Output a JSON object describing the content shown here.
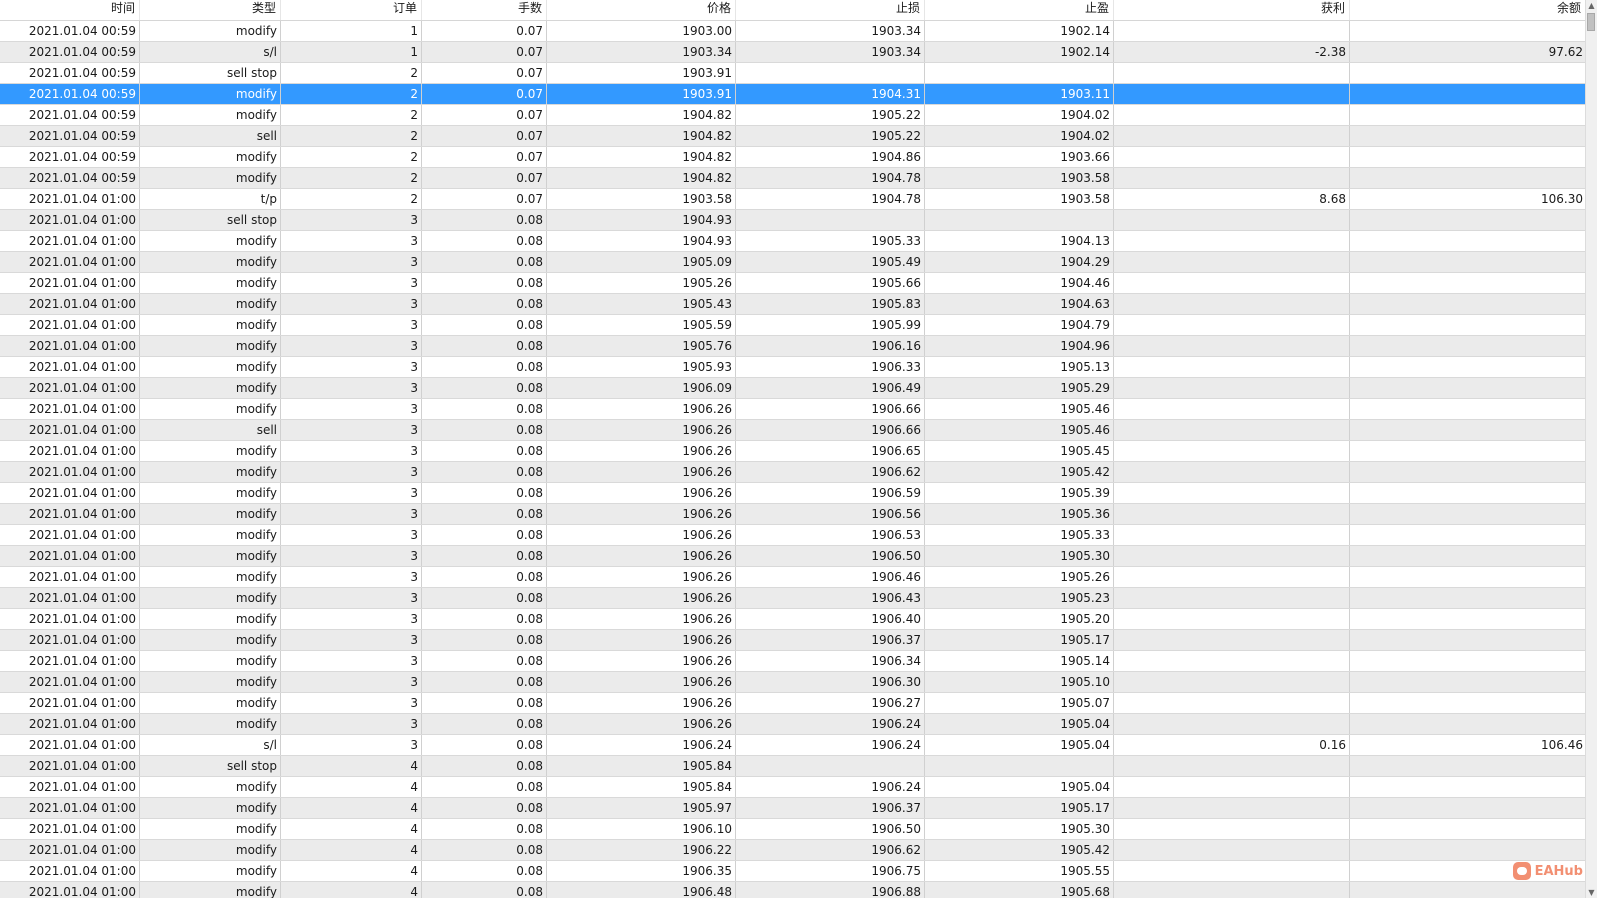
{
  "columns": [
    "时间",
    "类型",
    "订单",
    "手数",
    "价格",
    "止损",
    "止盈",
    "获利",
    "余额"
  ],
  "selected_row": 3,
  "rows": [
    [
      "2021.01.04 00:59",
      "modify",
      "1",
      "0.07",
      "1903.00",
      "1903.34",
      "1902.14",
      "",
      ""
    ],
    [
      "2021.01.04 00:59",
      "s/l",
      "1",
      "0.07",
      "1903.34",
      "1903.34",
      "1902.14",
      "-2.38",
      "97.62"
    ],
    [
      "2021.01.04 00:59",
      "sell stop",
      "2",
      "0.07",
      "1903.91",
      "",
      "",
      "",
      ""
    ],
    [
      "2021.01.04 00:59",
      "modify",
      "2",
      "0.07",
      "1903.91",
      "1904.31",
      "1903.11",
      "",
      ""
    ],
    [
      "2021.01.04 00:59",
      "modify",
      "2",
      "0.07",
      "1904.82",
      "1905.22",
      "1904.02",
      "",
      ""
    ],
    [
      "2021.01.04 00:59",
      "sell",
      "2",
      "0.07",
      "1904.82",
      "1905.22",
      "1904.02",
      "",
      ""
    ],
    [
      "2021.01.04 00:59",
      "modify",
      "2",
      "0.07",
      "1904.82",
      "1904.86",
      "1903.66",
      "",
      ""
    ],
    [
      "2021.01.04 00:59",
      "modify",
      "2",
      "0.07",
      "1904.82",
      "1904.78",
      "1903.58",
      "",
      ""
    ],
    [
      "2021.01.04 01:00",
      "t/p",
      "2",
      "0.07",
      "1903.58",
      "1904.78",
      "1903.58",
      "8.68",
      "106.30"
    ],
    [
      "2021.01.04 01:00",
      "sell stop",
      "3",
      "0.08",
      "1904.93",
      "",
      "",
      "",
      ""
    ],
    [
      "2021.01.04 01:00",
      "modify",
      "3",
      "0.08",
      "1904.93",
      "1905.33",
      "1904.13",
      "",
      ""
    ],
    [
      "2021.01.04 01:00",
      "modify",
      "3",
      "0.08",
      "1905.09",
      "1905.49",
      "1904.29",
      "",
      ""
    ],
    [
      "2021.01.04 01:00",
      "modify",
      "3",
      "0.08",
      "1905.26",
      "1905.66",
      "1904.46",
      "",
      ""
    ],
    [
      "2021.01.04 01:00",
      "modify",
      "3",
      "0.08",
      "1905.43",
      "1905.83",
      "1904.63",
      "",
      ""
    ],
    [
      "2021.01.04 01:00",
      "modify",
      "3",
      "0.08",
      "1905.59",
      "1905.99",
      "1904.79",
      "",
      ""
    ],
    [
      "2021.01.04 01:00",
      "modify",
      "3",
      "0.08",
      "1905.76",
      "1906.16",
      "1904.96",
      "",
      ""
    ],
    [
      "2021.01.04 01:00",
      "modify",
      "3",
      "0.08",
      "1905.93",
      "1906.33",
      "1905.13",
      "",
      ""
    ],
    [
      "2021.01.04 01:00",
      "modify",
      "3",
      "0.08",
      "1906.09",
      "1906.49",
      "1905.29",
      "",
      ""
    ],
    [
      "2021.01.04 01:00",
      "modify",
      "3",
      "0.08",
      "1906.26",
      "1906.66",
      "1905.46",
      "",
      ""
    ],
    [
      "2021.01.04 01:00",
      "sell",
      "3",
      "0.08",
      "1906.26",
      "1906.66",
      "1905.46",
      "",
      ""
    ],
    [
      "2021.01.04 01:00",
      "modify",
      "3",
      "0.08",
      "1906.26",
      "1906.65",
      "1905.45",
      "",
      ""
    ],
    [
      "2021.01.04 01:00",
      "modify",
      "3",
      "0.08",
      "1906.26",
      "1906.62",
      "1905.42",
      "",
      ""
    ],
    [
      "2021.01.04 01:00",
      "modify",
      "3",
      "0.08",
      "1906.26",
      "1906.59",
      "1905.39",
      "",
      ""
    ],
    [
      "2021.01.04 01:00",
      "modify",
      "3",
      "0.08",
      "1906.26",
      "1906.56",
      "1905.36",
      "",
      ""
    ],
    [
      "2021.01.04 01:00",
      "modify",
      "3",
      "0.08",
      "1906.26",
      "1906.53",
      "1905.33",
      "",
      ""
    ],
    [
      "2021.01.04 01:00",
      "modify",
      "3",
      "0.08",
      "1906.26",
      "1906.50",
      "1905.30",
      "",
      ""
    ],
    [
      "2021.01.04 01:00",
      "modify",
      "3",
      "0.08",
      "1906.26",
      "1906.46",
      "1905.26",
      "",
      ""
    ],
    [
      "2021.01.04 01:00",
      "modify",
      "3",
      "0.08",
      "1906.26",
      "1906.43",
      "1905.23",
      "",
      ""
    ],
    [
      "2021.01.04 01:00",
      "modify",
      "3",
      "0.08",
      "1906.26",
      "1906.40",
      "1905.20",
      "",
      ""
    ],
    [
      "2021.01.04 01:00",
      "modify",
      "3",
      "0.08",
      "1906.26",
      "1906.37",
      "1905.17",
      "",
      ""
    ],
    [
      "2021.01.04 01:00",
      "modify",
      "3",
      "0.08",
      "1906.26",
      "1906.34",
      "1905.14",
      "",
      ""
    ],
    [
      "2021.01.04 01:00",
      "modify",
      "3",
      "0.08",
      "1906.26",
      "1906.30",
      "1905.10",
      "",
      ""
    ],
    [
      "2021.01.04 01:00",
      "modify",
      "3",
      "0.08",
      "1906.26",
      "1906.27",
      "1905.07",
      "",
      ""
    ],
    [
      "2021.01.04 01:00",
      "modify",
      "3",
      "0.08",
      "1906.26",
      "1906.24",
      "1905.04",
      "",
      ""
    ],
    [
      "2021.01.04 01:00",
      "s/l",
      "3",
      "0.08",
      "1906.24",
      "1906.24",
      "1905.04",
      "0.16",
      "106.46"
    ],
    [
      "2021.01.04 01:00",
      "sell stop",
      "4",
      "0.08",
      "1905.84",
      "",
      "",
      "",
      ""
    ],
    [
      "2021.01.04 01:00",
      "modify",
      "4",
      "0.08",
      "1905.84",
      "1906.24",
      "1905.04",
      "",
      ""
    ],
    [
      "2021.01.04 01:00",
      "modify",
      "4",
      "0.08",
      "1905.97",
      "1906.37",
      "1905.17",
      "",
      ""
    ],
    [
      "2021.01.04 01:00",
      "modify",
      "4",
      "0.08",
      "1906.10",
      "1906.50",
      "1905.30",
      "",
      ""
    ],
    [
      "2021.01.04 01:00",
      "modify",
      "4",
      "0.08",
      "1906.22",
      "1906.62",
      "1905.42",
      "",
      ""
    ],
    [
      "2021.01.04 01:00",
      "modify",
      "4",
      "0.08",
      "1906.35",
      "1906.75",
      "1905.55",
      "",
      ""
    ],
    [
      "2021.01.04 01:00",
      "modify",
      "4",
      "0.08",
      "1906.48",
      "1906.88",
      "1905.68",
      "",
      ""
    ]
  ],
  "watermark": {
    "text": "EAHub",
    "icon": "eahub-logo-icon"
  },
  "colors": {
    "selection": "#3399ff",
    "row_alt": "#ebebeb"
  }
}
